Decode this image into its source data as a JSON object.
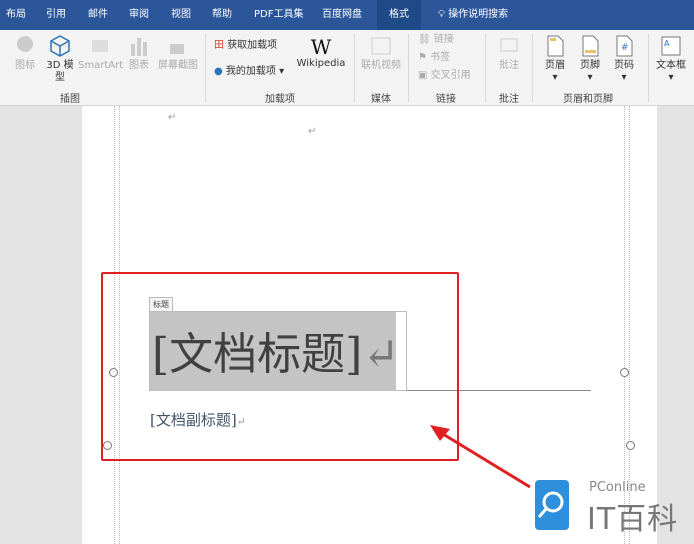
{
  "tabs": [
    "布局",
    "引用",
    "邮件",
    "审阅",
    "视图",
    "帮助",
    "PDF工具集",
    "百度网盘",
    "格式"
  ],
  "active_tab": "格式",
  "tell_me": "操作说明搜索",
  "ribbon": {
    "illustrations": {
      "icon": "图标",
      "model3d": "3D 模型",
      "smartart": "SmartArt",
      "chart": "图表",
      "screenshot": "屏幕截图",
      "label": "插图"
    },
    "addins": {
      "get": "获取加载项",
      "mine": "我的加载项",
      "wikipedia": "Wikipedia",
      "label": "加载项"
    },
    "media": {
      "online_video": "联机视频",
      "label": "媒体"
    },
    "links": {
      "link": "链接",
      "bookmark": "书签",
      "crossref": "交叉引用",
      "label": "链接"
    },
    "comments": {
      "comment": "批注",
      "label": "批注"
    },
    "headerfooter": {
      "header": "页眉",
      "footer": "页脚",
      "page_number": "页码",
      "label": "页眉和页脚"
    },
    "text": {
      "textbox": "文本框"
    }
  },
  "document": {
    "title_tag": "标题",
    "title": "[文档标题]",
    "subtitle": "[文档副标题]",
    "para_mark": "↵"
  },
  "watermark": {
    "brand": "PConline",
    "name": "IT百科"
  },
  "colors": {
    "tabbar": "#2b579a",
    "highlight": "#e02020"
  }
}
